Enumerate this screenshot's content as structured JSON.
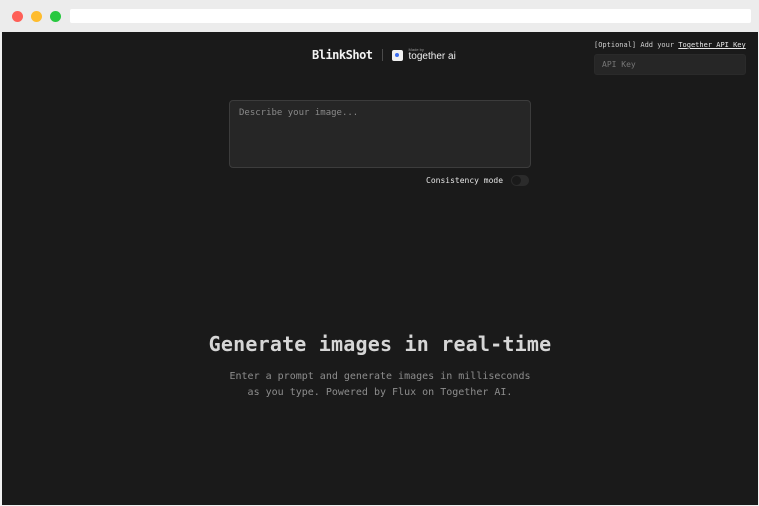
{
  "browser": {},
  "header": {
    "brand": "BlinkShot",
    "made_by": "Made by",
    "partner": "together ai"
  },
  "api_key": {
    "note_prefix": "[Optional] Add your ",
    "link_label": "Together API Key",
    "placeholder": "API Key"
  },
  "prompt": {
    "placeholder": "Describe your image..."
  },
  "consistency": {
    "label": "Consistency mode",
    "enabled": false
  },
  "hero": {
    "title": "Generate images in real-time",
    "subtitle_line1": "Enter a prompt and generate images in milliseconds",
    "subtitle_line2": "as you type. Powered by Flux on Together AI."
  },
  "colors": {
    "background": "#1a1a1a",
    "window_close": "#fe5f57",
    "window_minimize": "#febc2e",
    "window_maximize": "#28c840"
  },
  "icons": [
    "together-ai-logo-icon"
  ]
}
